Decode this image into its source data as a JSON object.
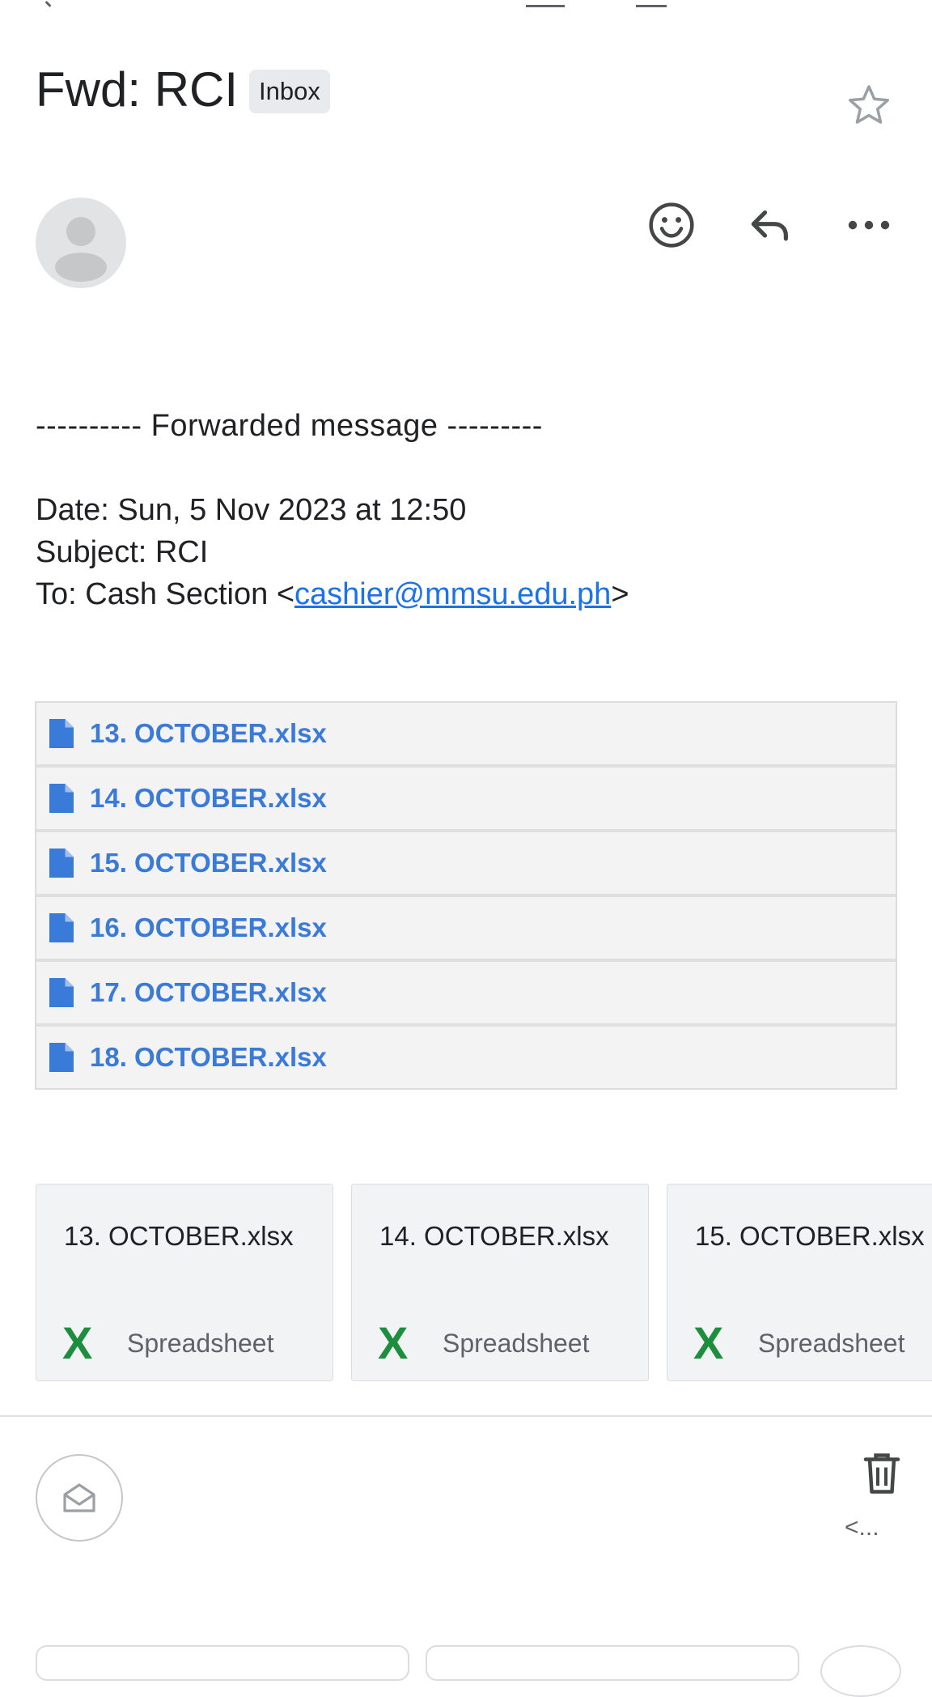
{
  "header": {
    "subject": "Fwd: RCI",
    "label": "Inbox"
  },
  "message": {
    "forwarded_line": "---------- Forwarded message ---------",
    "date_line": "Date: Sun, 5 Nov 2023 at 12:50",
    "subject_line": "Subject: RCI",
    "to_prefix": "To: Cash Section <",
    "to_email": "cashier@mmsu.edu.ph",
    "to_suffix": ">"
  },
  "attachments_list": [
    {
      "name": "13. OCTOBER.xlsx"
    },
    {
      "name": "14. OCTOBER.xlsx"
    },
    {
      "name": "15. OCTOBER.xlsx"
    },
    {
      "name": "16. OCTOBER.xlsx"
    },
    {
      "name": "17. OCTOBER.xlsx"
    },
    {
      "name": "18. OCTOBER.xlsx"
    }
  ],
  "attachment_cards": [
    {
      "name": "13. OCTOBER.xlsx",
      "type": "Spreadsheet",
      "icon_glyph": "X"
    },
    {
      "name": "14. OCTOBER.xlsx",
      "type": "Spreadsheet",
      "icon_glyph": "X"
    },
    {
      "name": "15. OCTOBER.xlsx",
      "type": "Spreadsheet",
      "icon_glyph": "X"
    }
  ],
  "second_message": {
    "more_text": "<..."
  },
  "icons": {
    "star": "star-icon",
    "emoji": "emoji-icon",
    "reply": "reply-icon",
    "more": "more-horizontal-icon",
    "file": "file-icon",
    "spreadsheet": "excel-icon",
    "envelope": "envelope-open-icon",
    "trash": "trash-icon"
  },
  "colors": {
    "link": "#1a73e8",
    "attachment_link": "#3a7ad8",
    "excel_green": "#1e8e3e",
    "chip_bg": "#e8eaed"
  }
}
